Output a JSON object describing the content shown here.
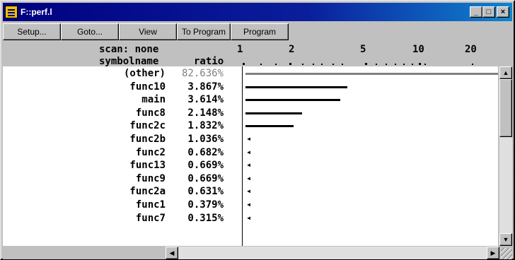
{
  "window": {
    "title": "F::perf.l"
  },
  "titlebar_buttons": {
    "minimize": "_",
    "maximize": "□",
    "close": "×"
  },
  "toolbar": {
    "buttons": [
      "Setup...",
      "Goto...",
      "View",
      "To Program",
      "Program"
    ]
  },
  "header": {
    "scan_label": "scan: none",
    "column_symbol": "symbolname",
    "column_ratio": "ratio",
    "scale_ticks": [
      "1",
      "2",
      "5",
      "10",
      "20"
    ]
  },
  "rows": [
    {
      "symbol": "(other)",
      "ratio": "82.636%",
      "value": 82.636
    },
    {
      "symbol": "func10",
      "ratio": "3.867%",
      "value": 3.867
    },
    {
      "symbol": "main",
      "ratio": "3.614%",
      "value": 3.614
    },
    {
      "symbol": "func8",
      "ratio": "2.148%",
      "value": 2.148
    },
    {
      "symbol": "func2c",
      "ratio": "1.832%",
      "value": 1.832
    },
    {
      "symbol": "func2b",
      "ratio": "1.036%",
      "value": 1.036
    },
    {
      "symbol": "func2",
      "ratio": "0.682%",
      "value": 0.682
    },
    {
      "symbol": "func13",
      "ratio": "0.669%",
      "value": 0.669
    },
    {
      "symbol": "func9",
      "ratio": "0.669%",
      "value": 0.669
    },
    {
      "symbol": "func2a",
      "ratio": "0.631%",
      "value": 0.631
    },
    {
      "symbol": "func1",
      "ratio": "0.379%",
      "value": 0.379
    },
    {
      "symbol": "func7",
      "ratio": "0.315%",
      "value": 0.315
    }
  ],
  "arrow_glyph": "◂",
  "scroll_glyphs": {
    "up": "▲",
    "down": "▼",
    "left": "◀",
    "right": "▶"
  },
  "colors": {
    "title_active": "#000080",
    "bar": "#000000",
    "other_bar": "#808080"
  }
}
